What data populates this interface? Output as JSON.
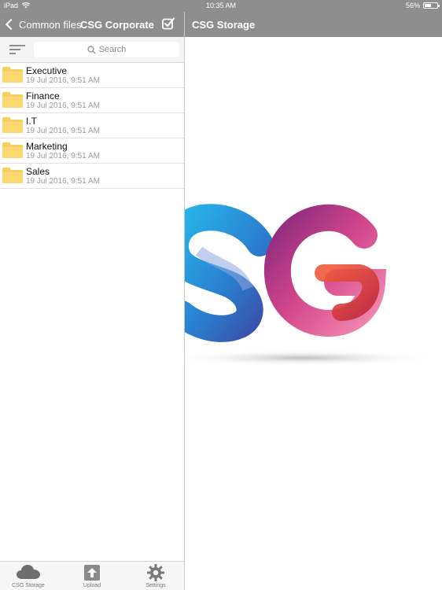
{
  "status_bar": {
    "device": "iPad",
    "time": "10:35 AM",
    "battery": "56%",
    "battery_level": 0.56
  },
  "header": {
    "back_label": "Common files",
    "folder_title": "CSG Corporate",
    "detail_title": "CSG Storage",
    "select_icon": "checkbox-icon"
  },
  "search": {
    "placeholder": "Search"
  },
  "files": [
    {
      "name": "Executive",
      "date": "19 Jul 2016, 9:51 AM"
    },
    {
      "name": "Finance",
      "date": "19 Jul 2016, 9:51 AM"
    },
    {
      "name": "I.T",
      "date": "19 Jul 2016, 9:51 AM"
    },
    {
      "name": "Marketing",
      "date": "19 Jul 2016, 9:51 AM"
    },
    {
      "name": "Sales",
      "date": "19 Jul 2016, 9:51 AM"
    }
  ],
  "tabs": [
    {
      "label": "CSG Storage",
      "icon": "cloud-icon"
    },
    {
      "label": "Upload",
      "icon": "upload-icon"
    },
    {
      "label": "Settings",
      "icon": "gear-icon"
    }
  ],
  "colors": {
    "bar": "#8e8e8e",
    "folder": "#fbcf5f",
    "logo_blue": "#2a7fd0",
    "logo_pink": "#c9357e"
  }
}
